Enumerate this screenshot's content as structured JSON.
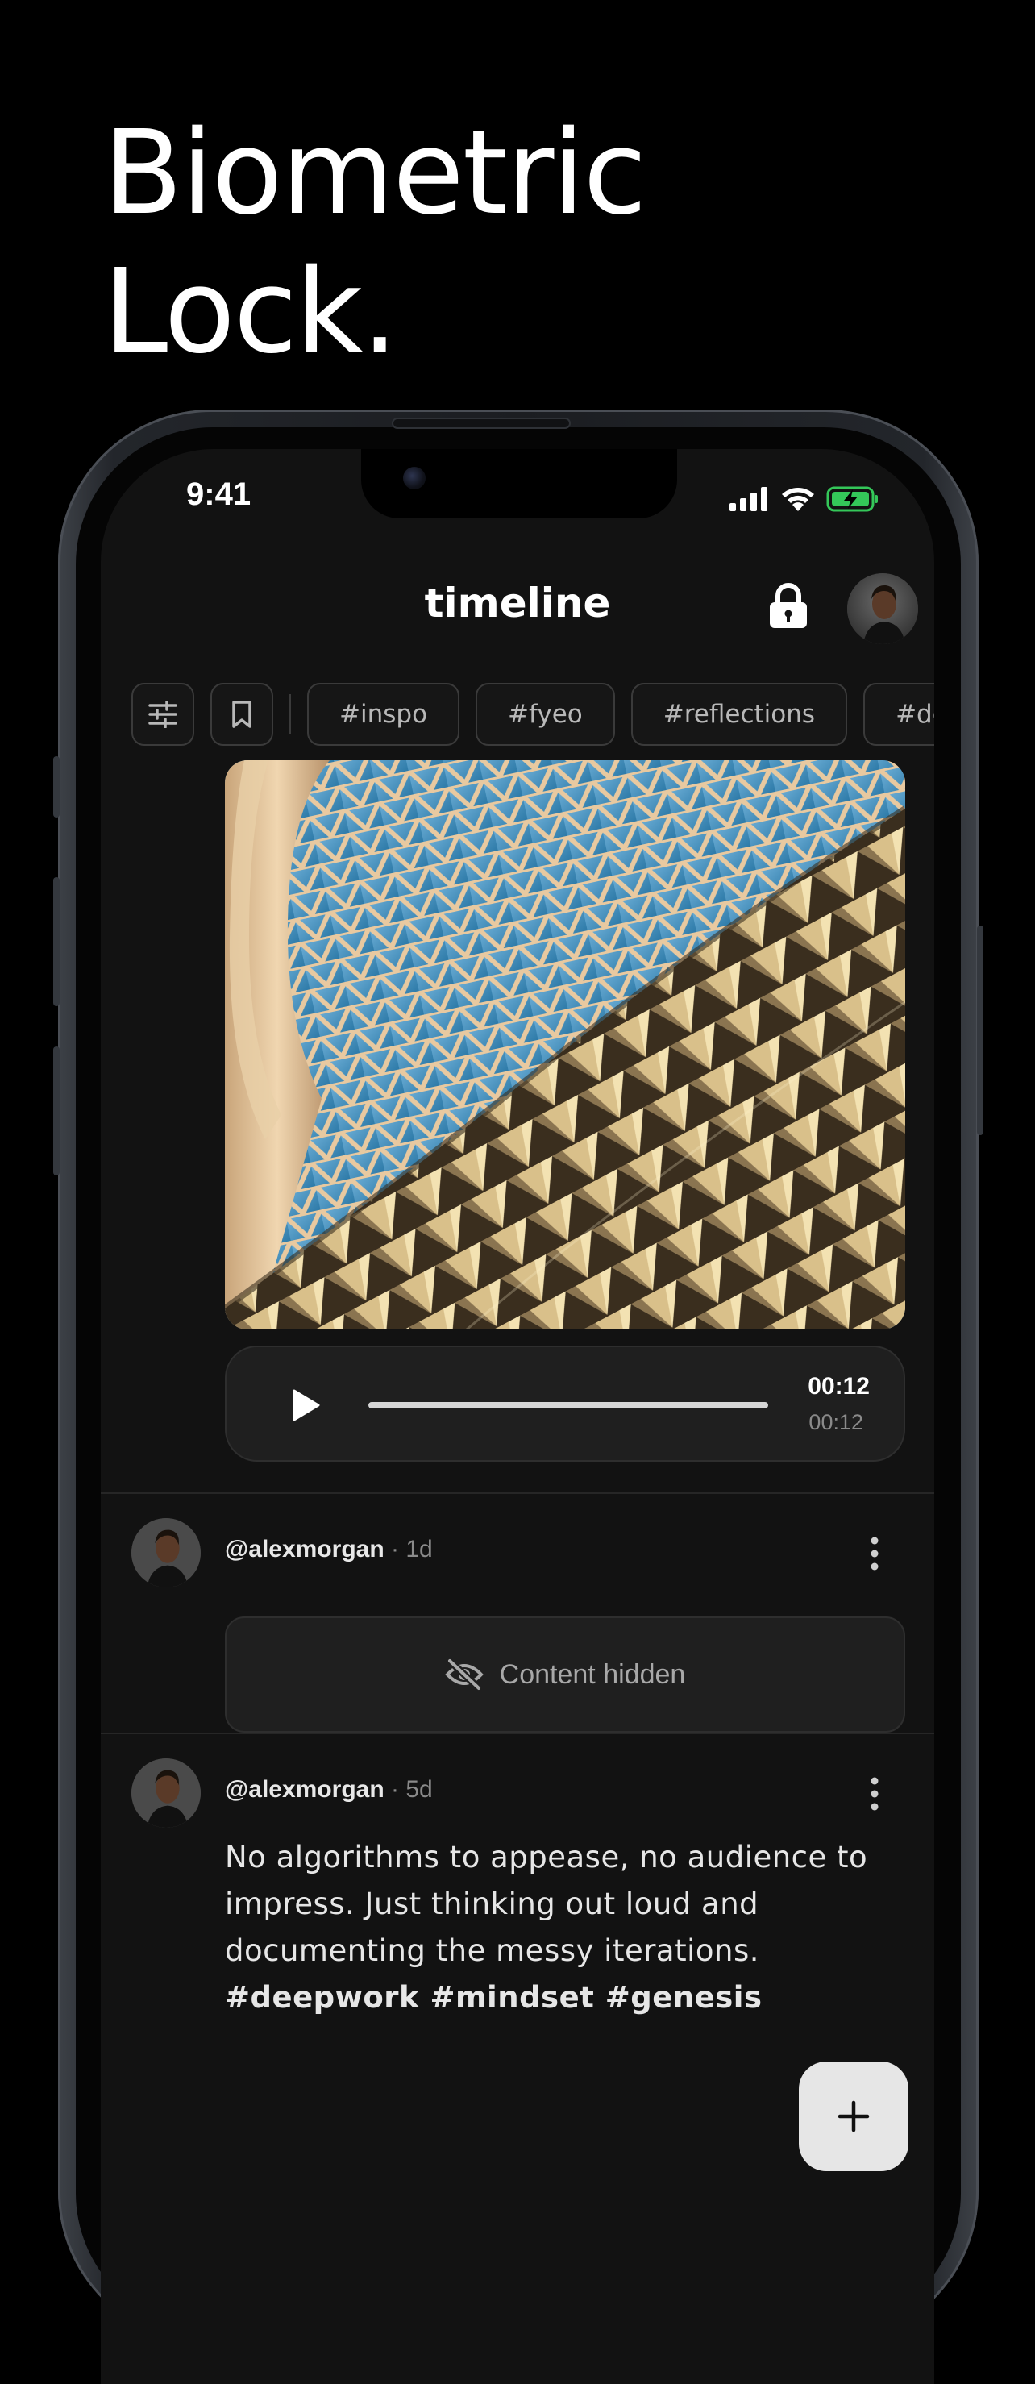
{
  "headline": {
    "line1": "Biometric",
    "line2": "Lock."
  },
  "status_bar": {
    "time": "9:41"
  },
  "header": {
    "title": "timeline"
  },
  "filters": {
    "tags": [
      "#inspo",
      "#fyeo",
      "#reflections",
      "#deep"
    ]
  },
  "audio": {
    "current": "00:12",
    "total": "00:12",
    "progress": 1.0
  },
  "posts": [
    {
      "handle": "@alexmorgan",
      "age": "1d",
      "hidden_label": "Content hidden"
    },
    {
      "handle": "@alexmorgan",
      "age": "5d",
      "text": "No algorithms to appease, no audience to impress. Just thinking out loud and documenting the messy iterations.",
      "hashtags": "#deepwork #mindset #genesis"
    }
  ],
  "colors": {
    "background": "#000000",
    "screen": "#121212",
    "card": "#1f1f1f",
    "battery_charging": "#34c759",
    "fab": "#e6e6e6"
  },
  "icons": {
    "lock": "lock-icon",
    "filter": "sliders-icon",
    "bookmark": "bookmark-icon",
    "play": "play-icon",
    "hidden": "eye-slash-icon",
    "more": "more-vertical-icon",
    "add": "plus-icon"
  }
}
